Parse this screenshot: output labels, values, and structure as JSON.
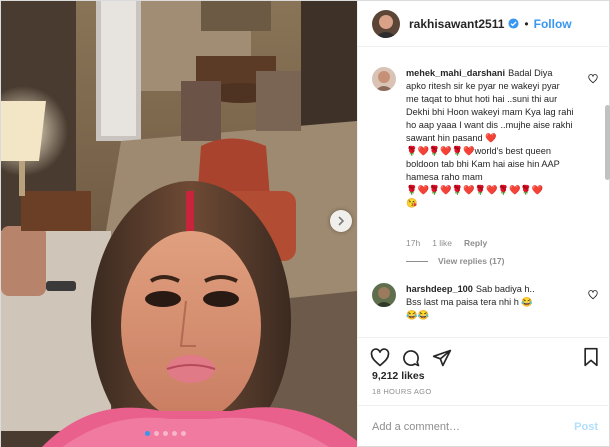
{
  "colors": {
    "accent": "#3897f0",
    "text": "#262626",
    "muted": "#8e8e8e",
    "border": "#efefef",
    "post_disabled": "#b2dffc"
  },
  "photo": {
    "carousel_next_icon": "chevron-right-icon",
    "dots_total": 5,
    "dots_active_index": 0
  },
  "header": {
    "username": "rakhisawant2511",
    "separator": "•",
    "follow_label": "Follow"
  },
  "comments": [
    {
      "username": "mehek_mahi_darshani",
      "text": "Badal Diya apko ritesh sir ke pyar ne wakeyi pyar me taqat to bhut hoti hai ..suni thi aur Dekhi bhi Hoon wakeyi mam Kya lag rahi ho aap yaaa I want dis ..mujhe aise rakhi sawant hin pasand ❤️\n🌹❤️🌹❤️🌹❤️world's best queen boldoon tab bhi Kam hai aise hin AAP hamesa raho mam\n🌹❤️🌹❤️🌹❤️🌹❤️🌹❤️🌹❤️\n😘",
      "time": "17h",
      "likes": "1 like",
      "reply_label": "Reply",
      "view_replies": "View replies (17)"
    },
    {
      "username": "harshdeep_100",
      "text": "Sab badiya h..\nBss last ma paisa tera nhi h 😂\n😂😂"
    }
  ],
  "likes": "9,212 likes",
  "time_ago": "18 HOURS AGO",
  "add_comment": {
    "placeholder": "Add a comment…",
    "post_label": "Post"
  }
}
